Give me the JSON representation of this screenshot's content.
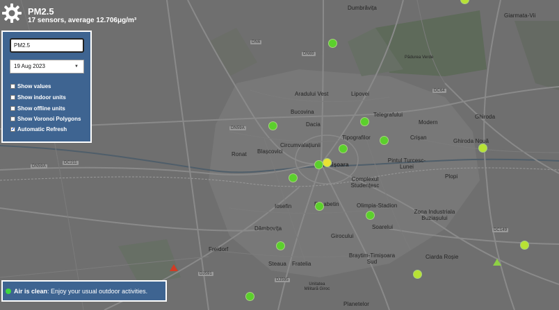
{
  "header": {
    "title": "PM2.5",
    "subtitle": "17 sensors, average 12.706μg/m³"
  },
  "controls": {
    "pollutant_value": "PM2.5",
    "date_value": "19 Aug 2023",
    "options": [
      {
        "label": "Show values",
        "checked": false
      },
      {
        "label": "Show indoor units",
        "checked": false
      },
      {
        "label": "Show offline units",
        "checked": false
      },
      {
        "label": "Show Voronoi Polygons",
        "checked": false
      },
      {
        "label": "Automatic Refresh",
        "checked": true
      }
    ]
  },
  "status": {
    "quality": "Air is clean",
    "message": ": Enjoy your usual outdoor activities.",
    "color": "#3fd93f"
  },
  "map": {
    "districts": [
      "Aradului Vest",
      "Lipovei",
      "Bucovina",
      "Dacia",
      "Telegrafului",
      "Modern",
      "Tipografilor",
      "Crișan",
      "Ghiroda Nouă",
      "Ronat",
      "Blașcovici",
      "Circumvalațiunii",
      "Timișoara",
      "Pintul Turcesc-Lunei",
      "Plopi",
      "Complexul Studențesc",
      "Iosefin",
      "Elisabetin",
      "Olimpia-Stadion",
      "Zona Industriala Buziașului",
      "Dâmbovița",
      "Soarelui",
      "Girocului",
      "Freidorf",
      "Steaua",
      "Fratelia",
      "Braytim-Timișoara Sud",
      "Ciarda Roșie",
      "Dumbrăvița",
      "Giarmata-Vii",
      "Ghiroda",
      "Planetelor",
      "Pădurea Verde",
      "Unitatea Militară Giroc"
    ],
    "road_labels": [
      "DN6",
      "DN69",
      "DN59A",
      "DC64",
      "DC211",
      "DN59A",
      "DC149",
      "DJ591",
      "DJ595",
      "DN69"
    ],
    "colors": {
      "sensor_clean": "#5bd02c",
      "sensor_good": "#b8e234",
      "sensor_moderate": "#e8e233",
      "panel": "#3e6491"
    }
  }
}
